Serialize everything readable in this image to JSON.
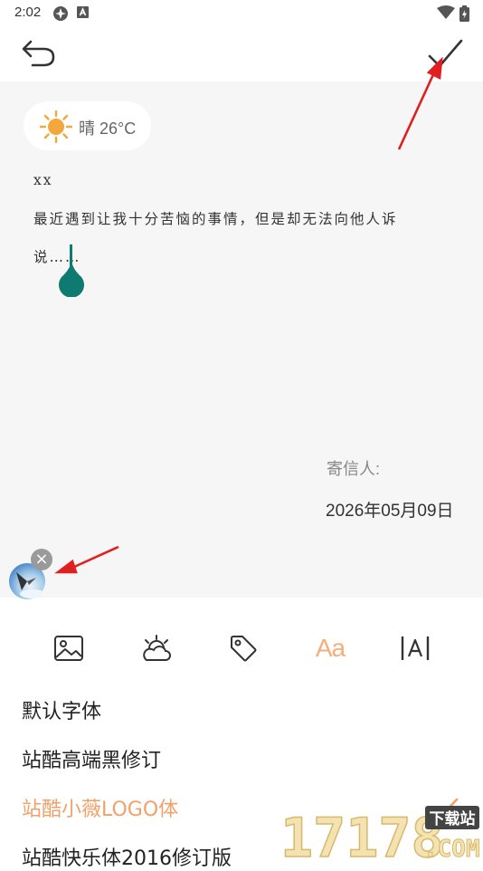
{
  "status_bar": {
    "time": "2:02"
  },
  "weather": {
    "icon": "sun-icon",
    "text": "晴 26°C"
  },
  "letter": {
    "greeting": "xx",
    "line1": "最近遇到让我十分苦恼的事情，但是却无法向他人诉",
    "line2": "说……"
  },
  "sender_label": "寄信人:",
  "date": "2026年05月09日",
  "toolbar": {
    "font_style_label": "Aa",
    "icons": [
      "image-icon",
      "weather-icon",
      "tag-icon",
      "font-style-icon",
      "text-size-icon"
    ]
  },
  "fonts": [
    {
      "label": "默认字体",
      "selected": false
    },
    {
      "label": "站酷高端黑修订",
      "selected": false
    },
    {
      "label": "站酷小薇LOGO体",
      "selected": true
    },
    {
      "label": "站酷快乐体2016修订版",
      "selected": false
    }
  ],
  "watermark": {
    "number": "17178",
    "tag": "下载站",
    "domain": ".COM"
  },
  "colors": {
    "accent": "#f2a16a",
    "cursor": "#0f7a70",
    "editor_bg": "#f6f6f6",
    "arrow": "#e02020"
  }
}
